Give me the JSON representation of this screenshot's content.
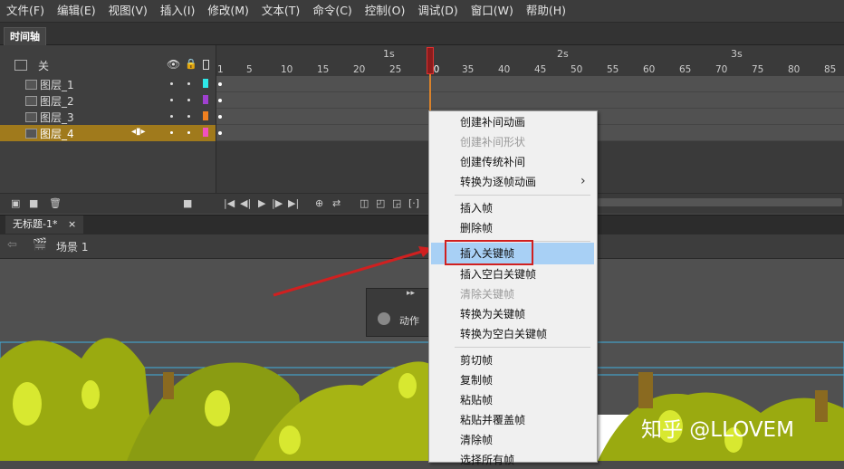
{
  "menubar": [
    "文件(F)",
    "编辑(E)",
    "视图(V)",
    "插入(I)",
    "修改(M)",
    "文本(T)",
    "命令(C)",
    "控制(O)",
    "调试(D)",
    "窗口(W)",
    "帮助(H)"
  ],
  "timeline": {
    "tab_label": "时间轴",
    "layers_header_label": "关",
    "layers": [
      {
        "name": "图层_1",
        "color": "#2ee8e8"
      },
      {
        "name": "图层_2",
        "color": "#a040d0"
      },
      {
        "name": "图层_3",
        "color": "#f08020"
      },
      {
        "name": "图层_4",
        "color": "#f050c0",
        "selected": true
      }
    ],
    "seconds": [
      "1s",
      "2s",
      "3s"
    ],
    "frame_ticks": [
      "1",
      "5",
      "10",
      "15",
      "20",
      "25",
      "30",
      "35",
      "40",
      "45",
      "50",
      "55",
      "60",
      "65",
      "70",
      "75",
      "80",
      "85"
    ],
    "current_frame": 30
  },
  "document": {
    "tab_title": "无标题-1*",
    "close_glyph": "×",
    "scene_label": "场景 1"
  },
  "actions_panel": {
    "label": "动作"
  },
  "context_menu": {
    "items": [
      {
        "label": "创建补间动画",
        "enabled": true
      },
      {
        "label": "创建补间形状",
        "enabled": false
      },
      {
        "label": "创建传统补间",
        "enabled": true
      },
      {
        "label": "转换为逐帧动画",
        "enabled": true,
        "submenu": true
      },
      {
        "label": "插入帧",
        "enabled": true
      },
      {
        "label": "删除帧",
        "enabled": true
      },
      {
        "label": "插入关键帧",
        "enabled": true,
        "highlighted": true
      },
      {
        "label": "插入空白关键帧",
        "enabled": true
      },
      {
        "label": "清除关键帧",
        "enabled": false
      },
      {
        "label": "转换为关键帧",
        "enabled": true
      },
      {
        "label": "转换为空白关键帧",
        "enabled": true
      },
      {
        "label": "剪切帧",
        "enabled": true
      },
      {
        "label": "复制帧",
        "enabled": true
      },
      {
        "label": "粘贴帧",
        "enabled": true
      },
      {
        "label": "粘贴并覆盖帧",
        "enabled": true
      },
      {
        "label": "清除帧",
        "enabled": true
      },
      {
        "label": "选择所有帧",
        "enabled": true
      }
    ],
    "submenu_glyph": "›"
  },
  "watermark": "知乎 @LLOVEM",
  "colors": {
    "highlight": "#a8d0f5",
    "annotation_red": "#d02020",
    "foliage": "#9aaa10"
  }
}
